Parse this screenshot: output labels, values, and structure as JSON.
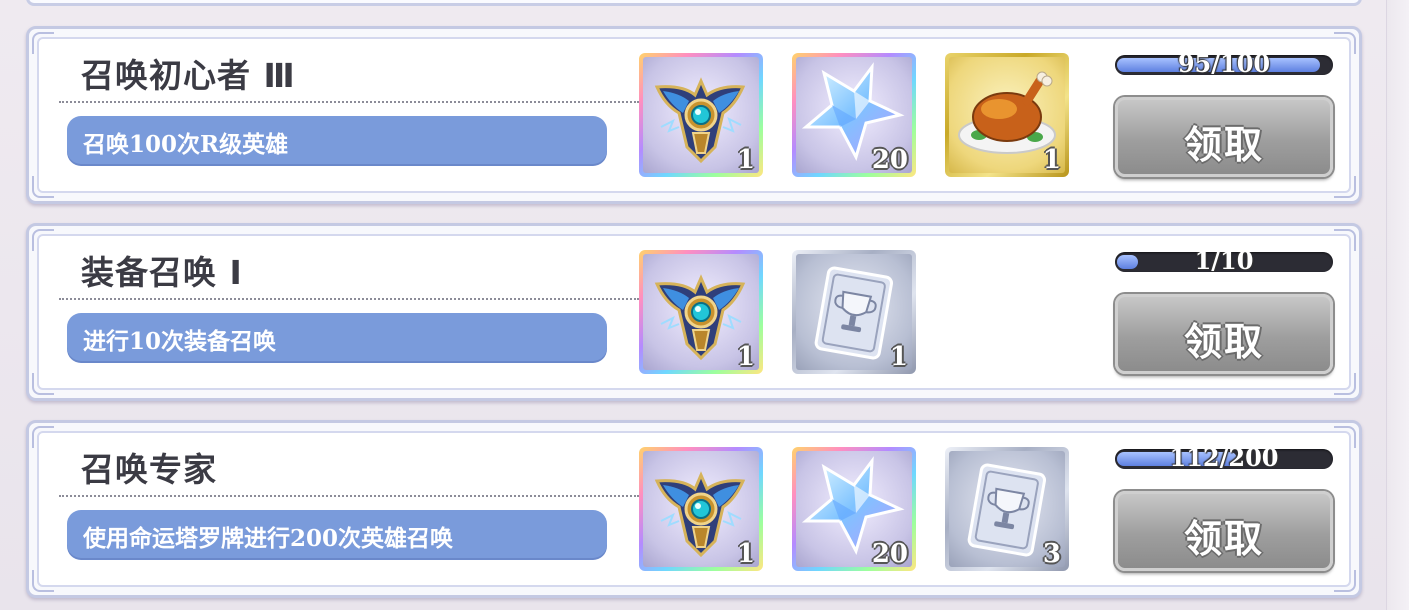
{
  "quests": [
    {
      "title": "召唤初心者 Ⅲ",
      "description": "召唤100次R级英雄",
      "progress_text": "95/100",
      "progress_fraction": 0.95,
      "claim_label": "领取",
      "rewards": [
        {
          "item": "summon-amulet-icon",
          "frame": "rainbow",
          "quantity": "1"
        },
        {
          "item": "crystal-star-icon",
          "frame": "rainbow",
          "quantity": "20"
        },
        {
          "item": "roast-chicken-icon",
          "frame": "gold",
          "quantity": "1"
        }
      ]
    },
    {
      "title": "装备召唤 Ⅰ",
      "description": "进行10次装备召唤",
      "progress_text": "1/10",
      "progress_fraction": 0.1,
      "claim_label": "领取",
      "rewards": [
        {
          "item": "summon-amulet-icon",
          "frame": "rainbow",
          "quantity": "1"
        },
        {
          "item": "trophy-card-icon",
          "frame": "silver",
          "quantity": "1"
        }
      ]
    },
    {
      "title": "召唤专家",
      "description": "使用命运塔罗牌进行200次英雄召唤",
      "progress_text": "112/200",
      "progress_fraction": 0.56,
      "claim_label": "领取",
      "rewards": [
        {
          "item": "summon-amulet-icon",
          "frame": "rainbow",
          "quantity": "1"
        },
        {
          "item": "crystal-star-icon",
          "frame": "rainbow",
          "quantity": "20"
        },
        {
          "item": "trophy-card-icon",
          "frame": "silver",
          "quantity": "3"
        }
      ]
    }
  ],
  "colors": {
    "description_bg": "#7a9bdb",
    "progress_fill": "#5e80e0",
    "claim_button": "#9e9e9e"
  }
}
